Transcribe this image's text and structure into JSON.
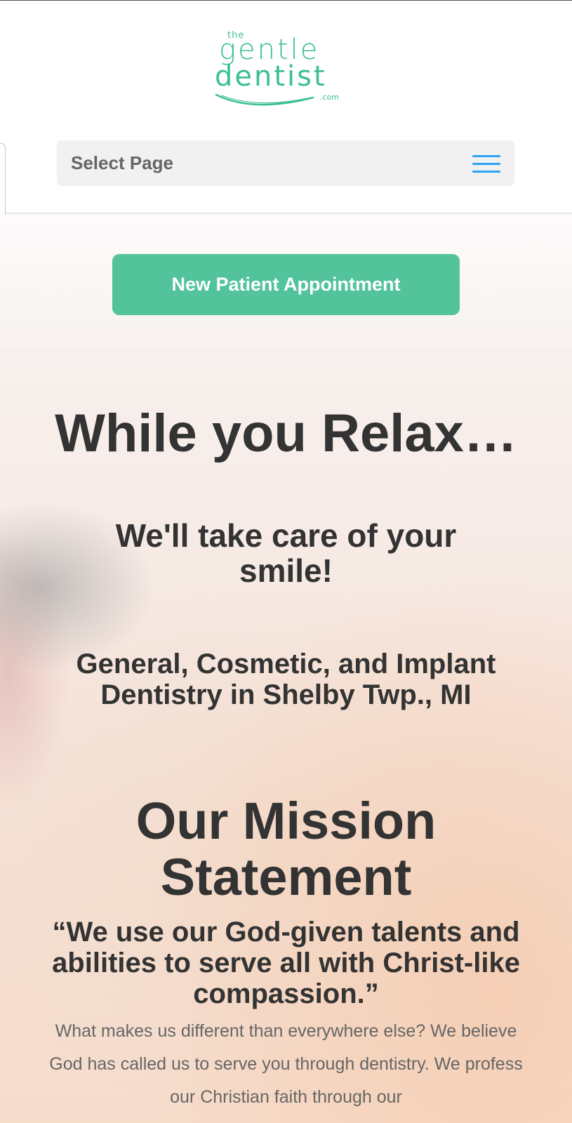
{
  "header": {
    "logo": {
      "the": "the",
      "gentle": "gentle",
      "dentist": "dentist",
      "com": ".com"
    },
    "nav": {
      "select_label": "Select Page",
      "menu_icon": "hamburger-menu-icon"
    }
  },
  "hero": {
    "cta_label": "New Patient Appointment",
    "headline": "While you Relax…",
    "subheadline": "We'll take care of your smile!",
    "services": "General, Cosmetic, and Implant Dentistry in Shelby Twp., MI",
    "mission_title": "Our Mission Statement",
    "mission_quote": "“We use our God-given talents and abilities to serve all with Christ-like compassion.”",
    "body": "What makes us different than everywhere else? We believe God has called us to serve you through dentistry. We profess our Christian faith through our"
  },
  "colors": {
    "brand_green": "#3cbf93",
    "cta_green": "#52c39b",
    "menu_blue": "#2ea3f2",
    "heading": "#333333",
    "body_text": "#666666"
  }
}
